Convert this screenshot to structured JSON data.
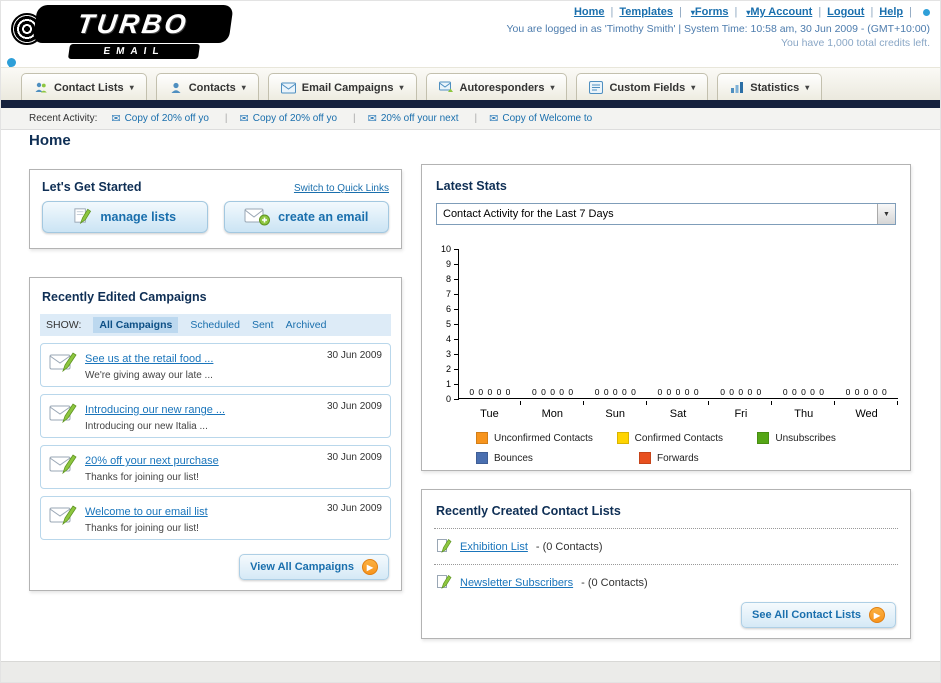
{
  "header": {
    "logo_primary": "TURBO",
    "logo_secondary": "EMAIL",
    "nav": [
      {
        "label": "Home"
      },
      {
        "label": "Templates"
      },
      {
        "label": "Forms"
      },
      {
        "label": "My Account"
      },
      {
        "label": "Logout"
      },
      {
        "label": "Help"
      }
    ]
  },
  "session": {
    "logged_in_text": "You are logged in as 'Timothy Smith' | System Time: 10:58 am, 30 Jun 2009 - (GMT+10:00)",
    "credits_text": "You have 1,000 total credits left."
  },
  "tabs": [
    {
      "label": "Contact Lists"
    },
    {
      "label": "Contacts"
    },
    {
      "label": "Email Campaigns"
    },
    {
      "label": "Autoresponders"
    },
    {
      "label": "Custom Fields"
    },
    {
      "label": "Statistics"
    }
  ],
  "activity": {
    "label": "Recent Activity:",
    "items": [
      {
        "text": "Copy of 20% off yo"
      },
      {
        "text": "Copy of 20% off yo"
      },
      {
        "text": "20% off your next"
      },
      {
        "text": "Copy of Welcome to"
      }
    ]
  },
  "home": {
    "title": "Home"
  },
  "get_started": {
    "title": "Let's Get Started",
    "switch_link": "Switch to Quick Links",
    "manage_lists_label": "manage lists",
    "create_email_label": "create an email"
  },
  "campaigns": {
    "title": "Recently Edited Campaigns",
    "show_label": "SHOW:",
    "filters": [
      "All Campaigns",
      "Scheduled",
      "Sent",
      "Archived"
    ],
    "items": [
      {
        "title": "See us at the retail food ...",
        "subtitle": "We're giving away our late ...",
        "date": "30 Jun 2009"
      },
      {
        "title": "Introducing our new range ...",
        "subtitle": "Introducing our new Italia ...",
        "date": "30 Jun 2009"
      },
      {
        "title": "20% off your next purchase",
        "subtitle": "Thanks for joining our list!",
        "date": "30 Jun 2009"
      },
      {
        "title": "Welcome to our email list",
        "subtitle": "Thanks for joining our list!",
        "date": "30 Jun 2009"
      }
    ],
    "view_all_label": "View All Campaigns"
  },
  "stats": {
    "title": "Latest Stats",
    "selector_value": "Contact Activity for the Last 7 Days"
  },
  "chart_data": {
    "type": "bar",
    "title": "Contact Activity for the Last 7 Days",
    "categories": [
      "Tue",
      "Mon",
      "Sun",
      "Sat",
      "Fri",
      "Thu",
      "Wed"
    ],
    "series": [
      {
        "name": "Unconfirmed Contacts",
        "color": "#f7941d",
        "values": [
          0,
          0,
          0,
          0,
          0,
          0,
          0
        ]
      },
      {
        "name": "Confirmed Contacts",
        "color": "#ffd400",
        "values": [
          0,
          0,
          0,
          0,
          0,
          0,
          0
        ]
      },
      {
        "name": "Unsubscribes",
        "color": "#55a616",
        "values": [
          0,
          0,
          0,
          0,
          0,
          0,
          0
        ]
      },
      {
        "name": "Bounces",
        "color": "#4a6fb0",
        "values": [
          0,
          0,
          0,
          0,
          0,
          0,
          0
        ]
      },
      {
        "name": "Forwards",
        "color": "#e8501f",
        "values": [
          0,
          0,
          0,
          0,
          0,
          0,
          0
        ]
      }
    ],
    "ylim": [
      0,
      10
    ],
    "ytick_step": 1,
    "grid": false,
    "legend_position": "bottom"
  },
  "contact_lists": {
    "title": "Recently Created Contact Lists",
    "items": [
      {
        "name": "Exhibition List",
        "count": "- (0 Contacts)"
      },
      {
        "name": "Newsletter Subscribers",
        "count": "- (0 Contacts)"
      }
    ],
    "see_all_label": "See All Contact Lists"
  },
  "icons": {
    "envelope": "✉",
    "chevron_down": "▾",
    "select_arrow": "▼",
    "arrow_right": "▶"
  }
}
